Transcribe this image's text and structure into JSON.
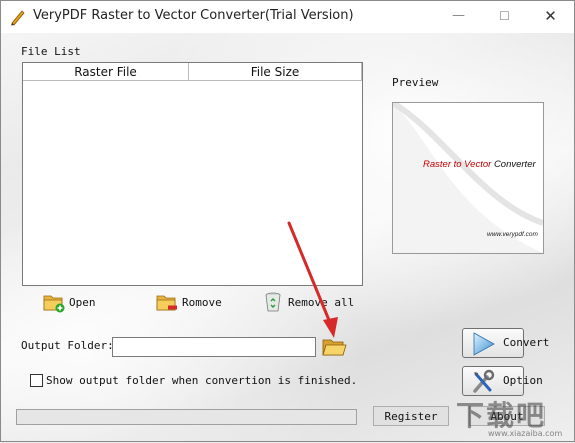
{
  "window": {
    "title": "VeryPDF Raster to Vector Converter(Trial Version)",
    "controls": {
      "minimize": "—",
      "maximize": "☐",
      "close": "✕"
    }
  },
  "file_list": {
    "group_label": "File List",
    "columns": [
      "Raster File",
      "File Size"
    ],
    "rows": []
  },
  "preview": {
    "label": "Preview",
    "title_red": "Raster to Vector",
    "title_black": "Converter",
    "url": "www.verypdf.com"
  },
  "toolbar": {
    "open_label": "Open",
    "remove_label": "Romove",
    "remove_all_label": "Remove all"
  },
  "output": {
    "label": "Output Folder:",
    "value": "",
    "show_folder_label": "Show output folder when convertion is finished.",
    "show_folder_checked": false
  },
  "actions": {
    "convert_label": "Convert",
    "option_label": "Option",
    "register_label": "Register",
    "about_label": "About"
  },
  "progress": {
    "value_percent": 0
  },
  "watermark": {
    "text": "下载吧",
    "url": "www.xiazaiba.com"
  },
  "colors": {
    "annotation_arrow": "#d62a2a",
    "preview_accent": "#c00000"
  }
}
